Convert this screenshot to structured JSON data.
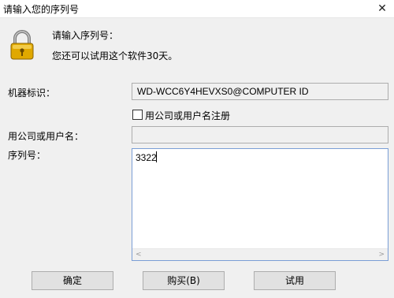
{
  "window": {
    "title": "请输入您的序列号",
    "close_symbol": "✕"
  },
  "header": {
    "icon": "lock-icon",
    "title": "请输入序列号：",
    "subtitle": "您还可以试用这个软件30天。"
  },
  "form": {
    "machine_id_label": "机器标识：",
    "machine_id_value": "WD-WCC6Y4HEVXS0@COMPUTER ID",
    "checkbox_label": "用公司或用户名注册",
    "checkbox_checked": false,
    "company_label": "用公司或用户名：",
    "company_value": "",
    "serial_label": "序列号：",
    "serial_value": "3322",
    "scroll_left": "<",
    "scroll_right": ">"
  },
  "buttons": {
    "ok": "确定",
    "buy": "购买(B)",
    "trial": "试用"
  },
  "colors": {
    "background": "#f0f0f0",
    "lock_gold": "#e0a800",
    "focus_border": "#7a9ed6"
  }
}
